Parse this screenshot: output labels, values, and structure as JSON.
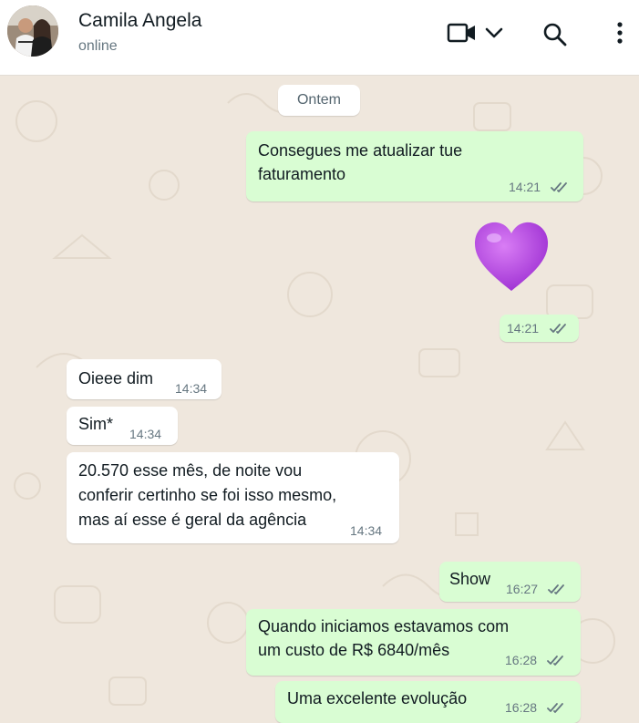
{
  "header": {
    "contact_name": "Camila Angela",
    "status": "online",
    "icons": [
      "video-call-icon",
      "chevron-down-icon",
      "search-icon",
      "more-vertical-icon"
    ]
  },
  "chat": {
    "date_divider": "Ontem",
    "messages": [
      {
        "direction": "outgoing",
        "lines": [
          "Consegues me atualizar tue",
          "faturamento"
        ],
        "time": "14:21",
        "status": "read"
      },
      {
        "direction": "outgoing",
        "emoji": "purple-heart",
        "time": "14:21",
        "status": "read"
      },
      {
        "direction": "incoming",
        "lines": [
          "Oieee dim"
        ],
        "time": "14:34"
      },
      {
        "direction": "incoming",
        "lines": [
          "Sim*"
        ],
        "time": "14:34"
      },
      {
        "direction": "incoming",
        "lines": [
          "20.570 esse mês, de noite vou",
          "conferir certinho se foi isso mesmo,",
          "mas aí esse é geral da agência"
        ],
        "time": "14:34"
      },
      {
        "direction": "outgoing",
        "lines": [
          "Show"
        ],
        "time": "16:27",
        "status": "read"
      },
      {
        "direction": "outgoing",
        "lines": [
          "Quando iniciamos estavamos com",
          "um custo de R$ 6840/mês"
        ],
        "time": "16:28",
        "status": "read"
      },
      {
        "direction": "outgoing",
        "lines": [
          "Uma excelente evolução"
        ],
        "time": "16:28",
        "status": "read"
      }
    ]
  },
  "colors": {
    "outgoing_bubble": "#d9fdd3",
    "incoming_bubble": "#ffffff",
    "chat_background": "#efe7dd",
    "read_ticks": "#667781",
    "heart": "#b14be0"
  }
}
